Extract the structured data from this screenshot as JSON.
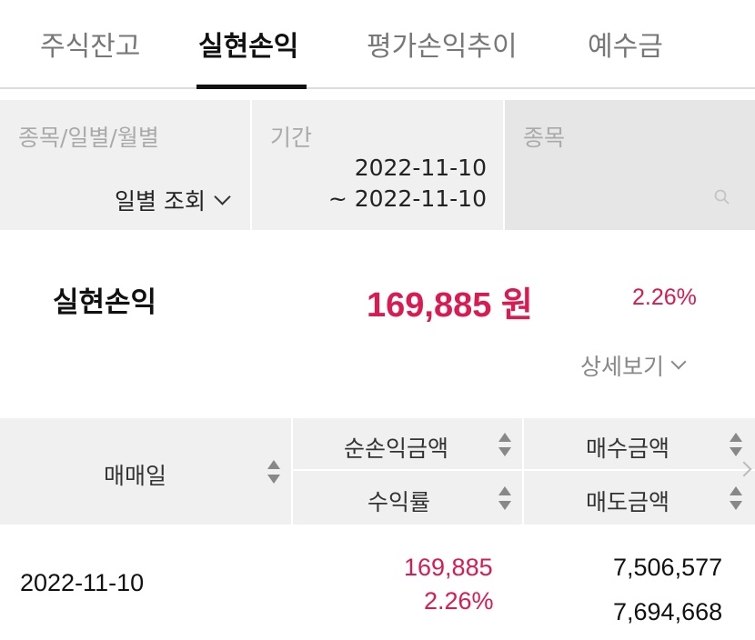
{
  "tabs": [
    {
      "label": "주식잔고"
    },
    {
      "label": "실현손익"
    },
    {
      "label": "평가손익추이"
    },
    {
      "label": "예수금"
    }
  ],
  "filter": {
    "type_label": "종목/일별/월별",
    "type_value": "일별 조회",
    "period_label": "기간",
    "period_start": "2022-11-10",
    "period_end": "~ 2022-11-10",
    "stock_label": "종목",
    "stock_placeholder": ""
  },
  "summary": {
    "label": "실현손익",
    "amount": "169,885 원",
    "rate": "2.26%",
    "detail_label": "상세보기"
  },
  "table": {
    "col_date": "매매일",
    "col_net_profit": "순손익금액",
    "col_rate": "수익률",
    "col_buy": "매수금액",
    "col_sell": "매도금액",
    "rows": [
      {
        "date": "2022-11-10",
        "net_profit": "169,885",
        "rate": "2.26%",
        "buy": "7,506,577",
        "sell": "7,694,668"
      }
    ]
  },
  "colors": {
    "accent_red": "#d81b50",
    "panel_gray": "#f0f0f0"
  }
}
